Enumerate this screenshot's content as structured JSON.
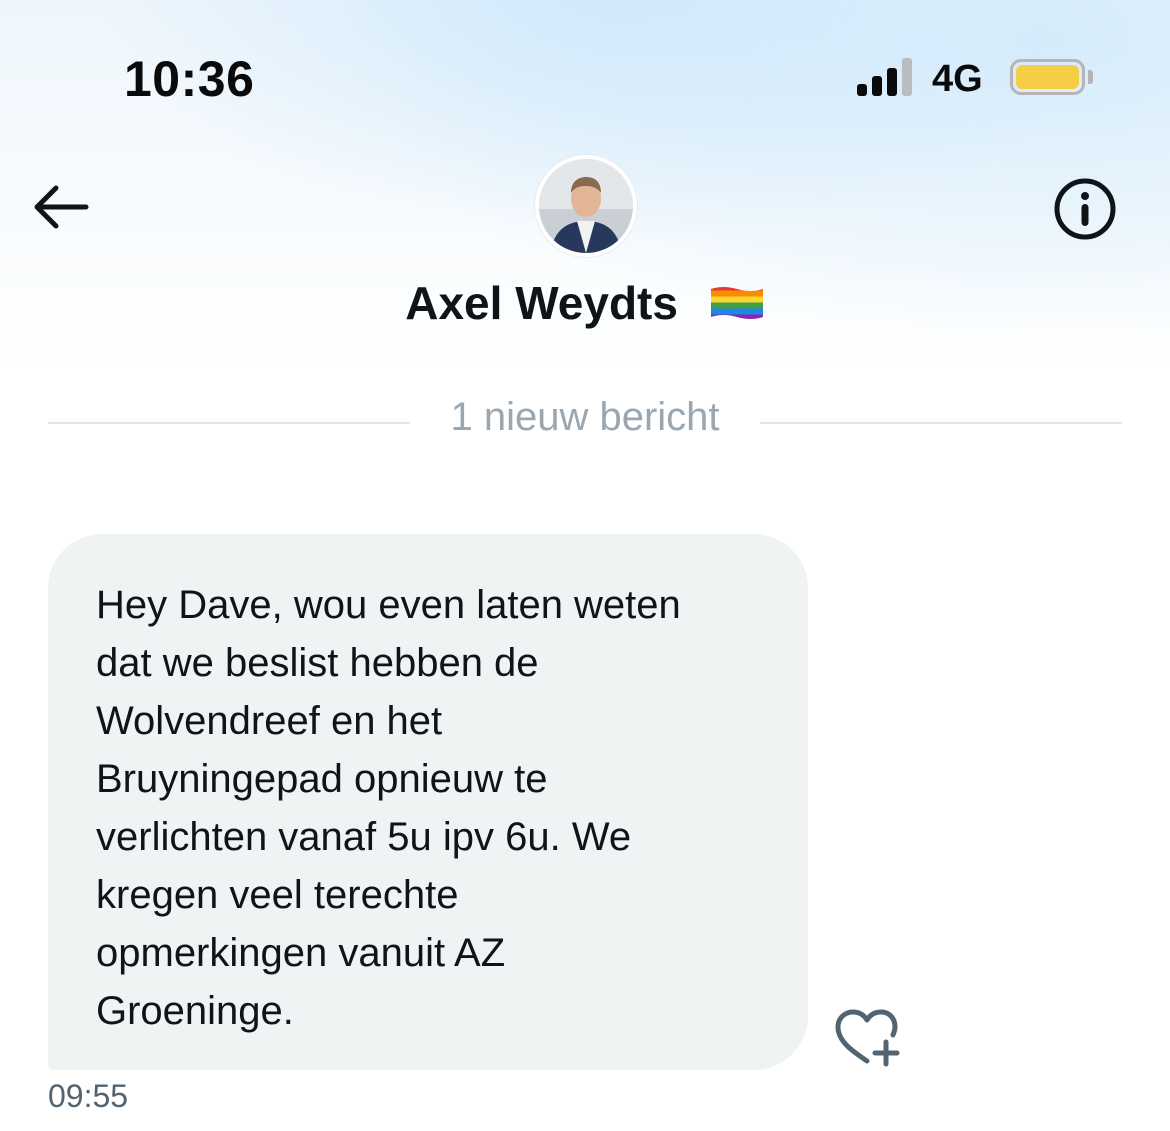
{
  "status_bar": {
    "time": "10:36",
    "network": "4G",
    "signal_bars_active": 3,
    "signal_bars_total": 4,
    "battery_color": "#f6cd45"
  },
  "header": {
    "back_icon": "arrow-left-icon",
    "info_icon": "info-circle-icon",
    "contact_name": "Axel Weydts",
    "contact_flag_icon": "rainbow-flag-icon"
  },
  "conversation": {
    "new_messages_label": "1 nieuw bericht",
    "messages": [
      {
        "text": "Hey Dave, wou even laten weten\ndat we beslist hebben de\nWolvendreef en het\nBruyningepad opnieuw te\nverlichten vanaf 5u ipv 6u. We\nkregen veel terechte\nopmerkingen vanuit AZ\nGroeninge.",
        "time": "09:55",
        "react_icon": "heart-plus-icon"
      }
    ]
  },
  "colors": {
    "bubble_background": "#eff3f4",
    "text_primary": "#0f1419",
    "text_secondary": "#536471",
    "divider_label": "#9aa6b0"
  }
}
